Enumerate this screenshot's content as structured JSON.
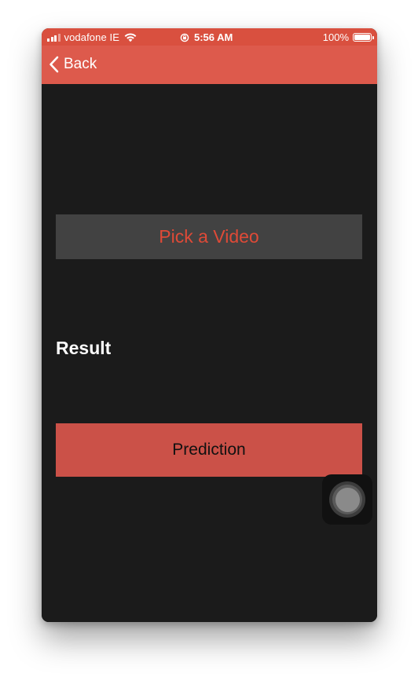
{
  "status_bar": {
    "carrier": "vodafone IE",
    "time": "5:56 AM",
    "battery": "100%",
    "battery_level": 1.0,
    "icons": [
      "signal-icon",
      "wifi-icon",
      "orientation-lock-icon",
      "battery-icon"
    ]
  },
  "nav": {
    "back_label": "Back",
    "back_icon": "chevron-left-icon"
  },
  "main": {
    "pick_button_label": "Pick a Video",
    "result_label": "Result",
    "prediction_button_label": "Prediction"
  },
  "colors": {
    "status_bar_bg": "#d9503f",
    "nav_bar_bg": "#dd5a4c",
    "background": "#1b1b1b",
    "pick_button_bg": "#424242",
    "pick_button_text": "#df4a37",
    "prediction_button_bg": "#cb5148"
  }
}
